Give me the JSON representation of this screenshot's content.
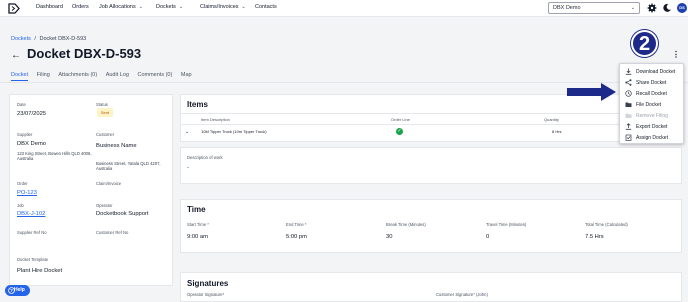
{
  "nav": {
    "items": [
      "Dashboard",
      "Orders",
      "Job Allocations",
      "Dockets",
      "Claims/Invoices",
      "Contacts"
    ],
    "org_select": "DBX Demo",
    "avatar_initials": "DS"
  },
  "breadcrumb": {
    "parent": "Dockets",
    "separator": "/",
    "current": "Docket DBX-D-593"
  },
  "page_title": "Docket DBX-D-593",
  "tabs": [
    "Docket",
    "Filing",
    "Attachments (0)",
    "Audit Log",
    "Comments (0)",
    "Map"
  ],
  "details": {
    "date_label": "Date",
    "date": "23/07/2025",
    "status_label": "Status",
    "status": "Sent",
    "supplier_label": "Supplier",
    "supplier": "DBX Demo",
    "supplier_address": "123 King Street, Bowen Hills QLD 4006, Australia",
    "customer_label": "Customer",
    "customer": "Business Name",
    "customer_address": "Business Street, Yatala QLD 4207, Australia",
    "order_label": "Order",
    "order": "PO-123",
    "claim_label": "Claim/Invoice",
    "job_label": "Job",
    "job": "DBX-J-102",
    "operator_label": "Operator",
    "operator": "Docketbook Support",
    "supplier_ref_label": "Supplier Ref No",
    "customer_ref_label": "Customer Ref No",
    "template_label": "Docket Template",
    "template": "Plant Hire Docket"
  },
  "items": {
    "title": "Items",
    "headers": {
      "description": "Item Description",
      "order_line": "Order Line",
      "quantity": "Quantity"
    },
    "row": {
      "description": "10M Tipper Truck (10m Tipper Truck)",
      "quantity": "8 Hrs"
    }
  },
  "work": {
    "label": "Description of work",
    "value": "-"
  },
  "time": {
    "title": "Time",
    "start_label": "Start Time *",
    "start": "9:00 am",
    "end_label": "End Time *",
    "end": "5:00 pm",
    "break_label": "Break Time (Minutes)",
    "break": "30",
    "travel_label": "Travel Time (Minutes)",
    "travel": "0",
    "total_label": "Total Time (Calculated)",
    "total": "7.5 Hrs"
  },
  "signatures": {
    "title": "Signatures",
    "operator_label": "Operator Signature*",
    "customer_label": "Customer Signature* (John)"
  },
  "menu": {
    "items": [
      "Download Docket",
      "Share Docket",
      "Recall Docket",
      "File Docket",
      "Remove Filing",
      "Export Docket",
      "Assign Docket"
    ]
  },
  "annotation": {
    "step": "2"
  },
  "help": "Help",
  "colors": {
    "accent": "#2563eb",
    "badge": "#1e2a8a",
    "status_bg": "#fef3c7",
    "status_fg": "#b45309",
    "success": "#16a34a"
  }
}
